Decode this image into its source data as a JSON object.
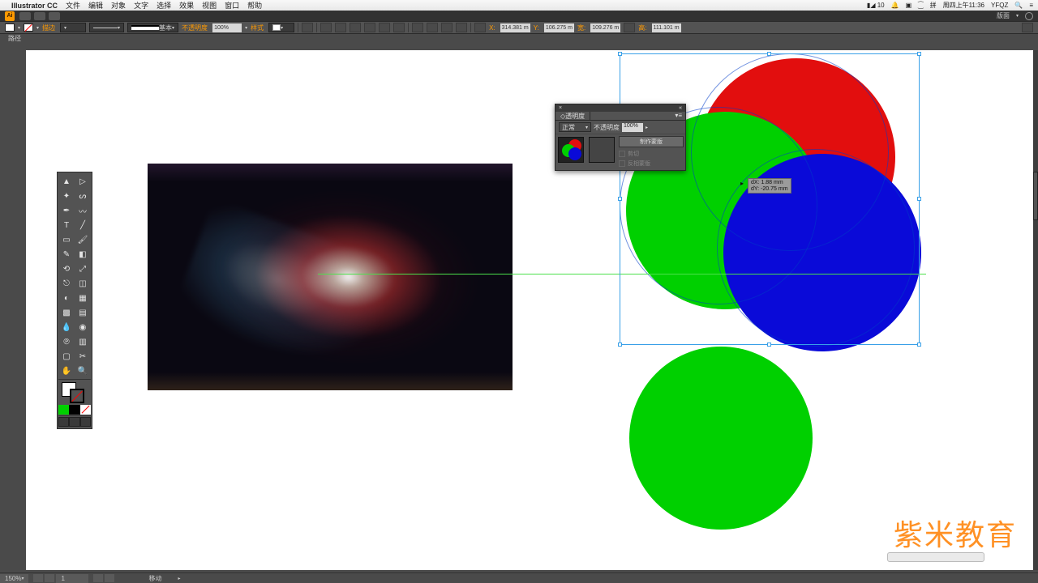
{
  "macos": {
    "app_name": "Illustrator CC",
    "menus": [
      "文件",
      "编辑",
      "对象",
      "文字",
      "选择",
      "效果",
      "视图",
      "窗口",
      "帮助"
    ],
    "status": {
      "cc": "10",
      "time": "周四上午11:36",
      "user": "YFQZ"
    }
  },
  "aitop": {
    "ai_label": "Ai",
    "workspace": "版面"
  },
  "control": {
    "leftlabel": "路径",
    "stroke_label": "描边",
    "stroke_pt": "",
    "profile": "基本",
    "opacity_label": "不透明度",
    "opacity_val": "100%",
    "style_label": "样式",
    "X_label": "X:",
    "Y_label": "Y:",
    "W_label": "宽:",
    "H_label": "高:",
    "X": "314.381 m",
    "Y": "106.275 m",
    "W": "109.276 m",
    "H": "111.101 m"
  },
  "transparency": {
    "title": "透明度",
    "blend": "正常",
    "op_label": "不透明度",
    "op_val": "100%",
    "mask_btn": "制作蒙版",
    "clip": "剪切",
    "invert": "反相蒙版"
  },
  "dragtip": {
    "dx": "dX: 1.88 mm",
    "dy": "dY: -20.75 mm"
  },
  "statusbar": {
    "zoom": "150%",
    "mode": "移动"
  },
  "watermark": "紫米教育"
}
